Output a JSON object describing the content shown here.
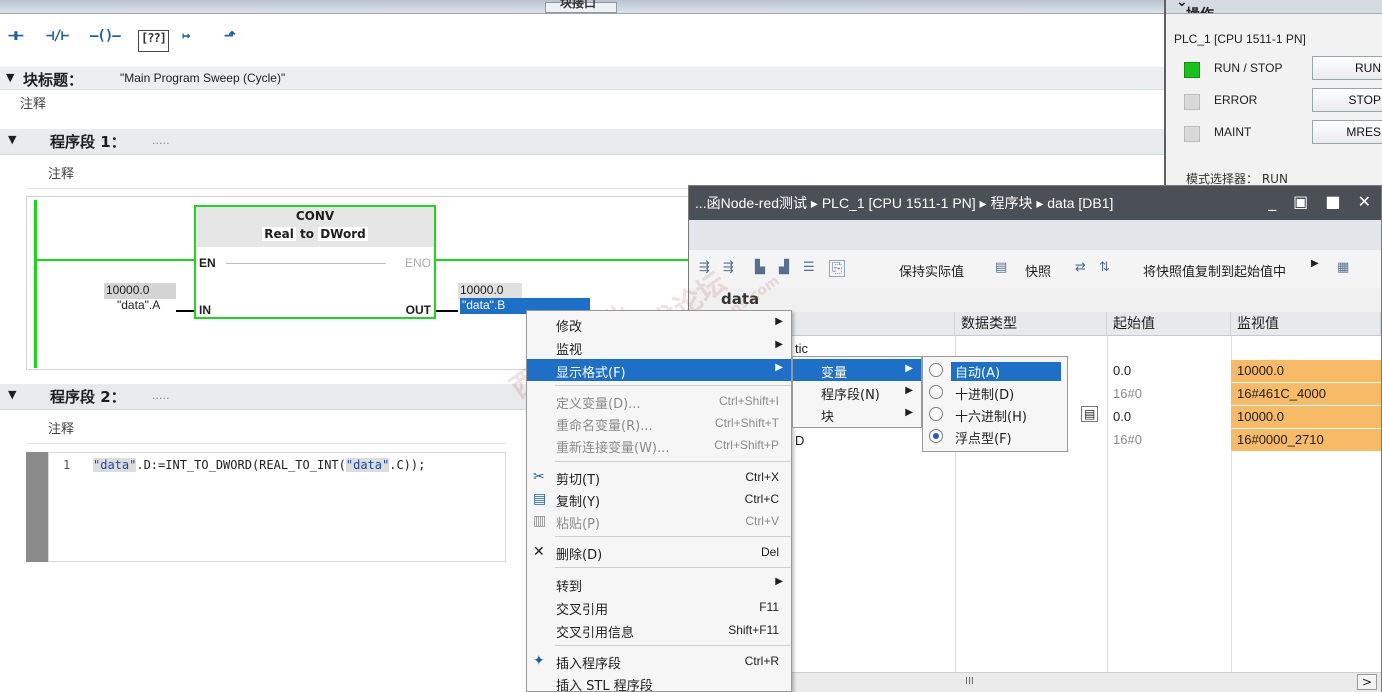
{
  "top_strip": {
    "title": "块接口"
  },
  "lad_toolbar": {
    "icons": [
      "normally-open-contact-icon",
      "normally-closed-contact-icon",
      "coil-icon",
      "empty-box-icon",
      "open-branch-icon",
      "close-branch-icon"
    ],
    "glyphs": [
      "⊣⊢",
      "⊣/⊢",
      "–()–",
      "[??]",
      "↦",
      "⬏"
    ]
  },
  "block": {
    "title_label": "块标题：",
    "title_value": "\"Main Program Sweep (Cycle)\"",
    "comment": "注释"
  },
  "network1": {
    "label": "程序段 1：",
    "dots": ".....",
    "comment": "注释",
    "conv": {
      "name": "CONV",
      "from_type": "Real",
      "to_word": "to",
      "to_type": "DWord",
      "pin_en": "EN",
      "pin_eno": "ENO",
      "pin_in": "IN",
      "pin_out": "OUT"
    },
    "in_value": "10000.0",
    "in_operand": "\"data\".A",
    "out_value": "10000.0",
    "out_operand": "\"data\".B"
  },
  "network2": {
    "label": "程序段 2：",
    "dots": ".....",
    "comment": "注释",
    "line_no": "1",
    "code_pre": "",
    "code_tag1": "\"data\"",
    "code_mid": ".D:=INT_TO_DWORD(REAL_TO_INT(",
    "code_tag2": "\"data\"",
    "code_post": ".C));"
  },
  "cpu_panel": {
    "title": "CPU 操作面板",
    "device": "PLC_1 [CPU 1511-1 PN]",
    "leds": [
      {
        "label": "RUN / STOP",
        "on": true
      },
      {
        "label": "ERROR",
        "on": false
      },
      {
        "label": "MAINT",
        "on": false
      }
    ],
    "buttons": [
      "RUN",
      "STOP",
      "MRES"
    ],
    "mode_label": "模式选择器：",
    "mode_value": "RUN"
  },
  "db_window": {
    "path": "...函Node-red测试 ▸ PLC_1 [CPU 1511-1 PN] ▸ 程序块 ▸ data [DB1]",
    "window_buttons": "_ ▣ ■ ✕",
    "toolbar": {
      "keep_actual": "保持实际值",
      "snapshot": "快照",
      "copy_snapshot": "将快照值复制到起始值中"
    },
    "db_name": "data",
    "columns": [
      "数据类型",
      "起始值",
      "监视值"
    ],
    "static_label": "tic",
    "row_d_label": "D",
    "rows": [
      {
        "start": "0.0",
        "monitor": "10000.0",
        "start_gray": false
      },
      {
        "start": "16#0",
        "monitor": "16#461C_4000",
        "start_gray": true
      },
      {
        "start": "0.0",
        "monitor": "10000.0",
        "start_gray": false
      },
      {
        "start": "16#0",
        "monitor": "16#0000_2710",
        "start_gray": true
      }
    ],
    "scroll_mid": "III"
  },
  "context_menu": {
    "items": [
      {
        "label": "修改",
        "shortcut": "",
        "arrow": true,
        "disabled": false,
        "selected": false,
        "icon": ""
      },
      {
        "label": "监视",
        "shortcut": "",
        "arrow": true,
        "disabled": false,
        "selected": false,
        "icon": ""
      },
      {
        "label": "显示格式(F)",
        "shortcut": "",
        "arrow": true,
        "disabled": false,
        "selected": true,
        "icon": ""
      },
      {
        "label": "定义变量(D)...",
        "shortcut": "Ctrl+Shift+I",
        "arrow": false,
        "disabled": true,
        "selected": false,
        "icon": ""
      },
      {
        "label": "重命名变量(R)...",
        "shortcut": "Ctrl+Shift+T",
        "arrow": false,
        "disabled": true,
        "selected": false,
        "icon": ""
      },
      {
        "label": "重新连接变量(W)...",
        "shortcut": "Ctrl+Shift+P",
        "arrow": false,
        "disabled": true,
        "selected": false,
        "icon": ""
      },
      {
        "label": "剪切(T)",
        "shortcut": "Ctrl+X",
        "arrow": false,
        "disabled": false,
        "selected": false,
        "icon": "✂"
      },
      {
        "label": "复制(Y)",
        "shortcut": "Ctrl+C",
        "arrow": false,
        "disabled": false,
        "selected": false,
        "icon": "▤"
      },
      {
        "label": "粘贴(P)",
        "shortcut": "Ctrl+V",
        "arrow": false,
        "disabled": true,
        "selected": false,
        "icon": "▥"
      },
      {
        "label": "删除(D)",
        "shortcut": "Del",
        "arrow": false,
        "disabled": false,
        "selected": false,
        "icon": "✕"
      },
      {
        "label": "转到",
        "shortcut": "",
        "arrow": true,
        "disabled": false,
        "selected": false,
        "icon": ""
      },
      {
        "label": "交叉引用",
        "shortcut": "F11",
        "arrow": false,
        "disabled": false,
        "selected": false,
        "icon": ""
      },
      {
        "label": "交叉引用信息",
        "shortcut": "Shift+F11",
        "arrow": false,
        "disabled": false,
        "selected": false,
        "icon": ""
      },
      {
        "label": "插入程序段",
        "shortcut": "Ctrl+R",
        "arrow": false,
        "disabled": false,
        "selected": false,
        "icon": "✦"
      },
      {
        "label": "插入 STL 程序段",
        "shortcut": "",
        "arrow": false,
        "disabled": false,
        "selected": false,
        "icon": ""
      }
    ]
  },
  "submenu_format": {
    "items": [
      {
        "label": "变量",
        "selected": true
      },
      {
        "label": "程序段(N)",
        "selected": false
      },
      {
        "label": "块",
        "selected": false
      }
    ]
  },
  "submenu_radix": {
    "items": [
      {
        "label": "自动(A)",
        "checked": false,
        "selected": true
      },
      {
        "label": "十进制(D)",
        "checked": false,
        "selected": false
      },
      {
        "label": "十六进制(H)",
        "checked": false,
        "selected": false
      },
      {
        "label": "浮点型(F)",
        "checked": true,
        "selected": false
      }
    ]
  },
  "watermark": {
    "lines": [
      "西门子工业",
      "技术论坛",
      "support.industry.siemens.com"
    ]
  }
}
